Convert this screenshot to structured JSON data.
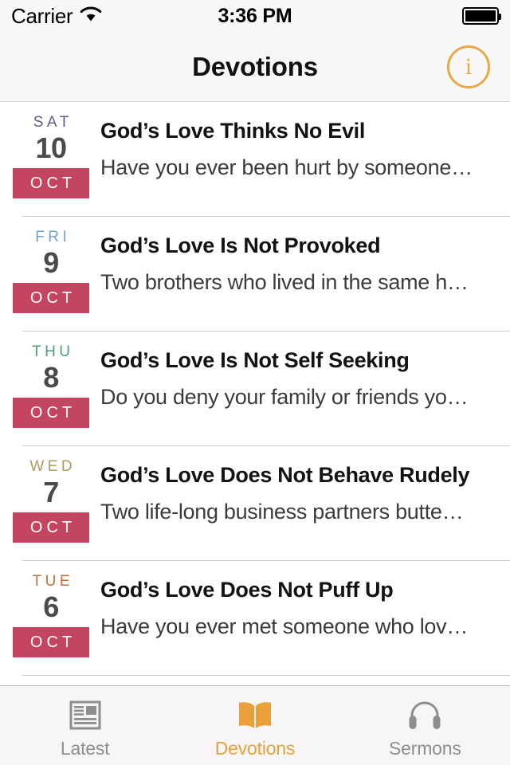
{
  "status_bar": {
    "carrier": "Carrier",
    "wifi_icon": "wifi-icon",
    "time": "3:36 PM",
    "battery_icon": "battery-full-icon",
    "battery_level_percent": 100
  },
  "nav_bar": {
    "title": "Devotions",
    "info_button": {
      "icon": "info-circle-icon",
      "glyph": "i",
      "color": "#e8a94a"
    }
  },
  "theme": {
    "accent": "#e8a13a",
    "month_badge_bg": "#c4455f",
    "month_badge_text": "#ffffff",
    "day_number": "#4a4a4a",
    "separator": "#c8c7cc",
    "bar_background": "#f7f7f7",
    "tab_inactive": "#8e8e8e"
  },
  "list": {
    "rows": [
      {
        "dow": "SAT",
        "dow_color": "#5a5f8f",
        "day": "10",
        "month": "OCT",
        "title": "God’s Love Thinks No Evil",
        "excerpt": "Have you ever been hurt by someone…"
      },
      {
        "dow": "FRI",
        "dow_color": "#6fa4c2",
        "day": "9",
        "month": "OCT",
        "title": "God’s Love Is Not Provoked",
        "excerpt": "Two brothers who lived in the same h…"
      },
      {
        "dow": "THU",
        "dow_color": "#4e9e72",
        "day": "8",
        "month": "OCT",
        "title": "God’s Love Is Not Self Seeking",
        "excerpt": "Do you deny your family or friends yo…"
      },
      {
        "dow": "WED",
        "dow_color": "#b09a5e",
        "day": "7",
        "month": "OCT",
        "title": "God’s Love Does Not Behave Rudely",
        "excerpt": "Two life-long business partners butte…"
      },
      {
        "dow": "TUE",
        "dow_color": "#c0703a",
        "day": "6",
        "month": "OCT",
        "title": "God’s Love Does Not Puff Up",
        "excerpt": "Have you ever met someone who lov…"
      }
    ]
  },
  "tab_bar": {
    "tabs": [
      {
        "label": "Latest",
        "icon": "newspaper-icon",
        "active": false
      },
      {
        "label": "Devotions",
        "icon": "open-book-icon",
        "active": true
      },
      {
        "label": "Sermons",
        "icon": "headphones-icon",
        "active": false
      }
    ]
  }
}
